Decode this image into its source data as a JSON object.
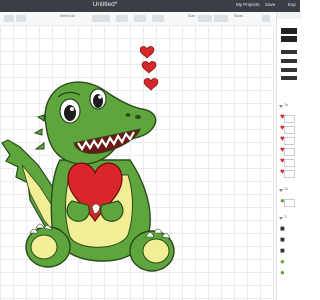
{
  "window": {
    "title": "Untitled*"
  },
  "header_links": {
    "my_projects": "My Projects",
    "save": "Save",
    "export": "Exp"
  },
  "toolbar": {
    "select_all": "Select All",
    "size": "Size",
    "view": "Show"
  },
  "panel": {
    "section_1": "Ta",
    "section_2": "Ta",
    "section_3": "Ti"
  },
  "colors": {
    "topbar": "#3b3f45",
    "croc_green": "#5fa53e",
    "croc_belly": "#f1ee96",
    "heart": "#d8262b",
    "accent": "#2f7ef5"
  }
}
